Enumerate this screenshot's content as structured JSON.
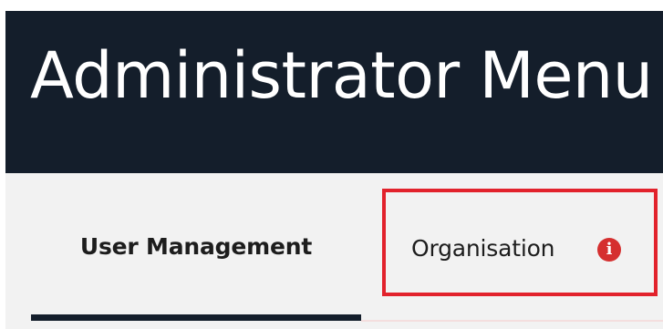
{
  "header": {
    "title": "Administrator Menu",
    "background": "#141e2b"
  },
  "tabs": [
    {
      "label": "User Management",
      "active": true
    },
    {
      "label": "Organisation",
      "active": false,
      "highlighted": true,
      "icon": "info-icon"
    }
  ],
  "colors": {
    "header_bg": "#141e2b",
    "tab_bar_bg": "#f2f2f2",
    "highlight_border": "#e2222c",
    "info_icon": "#d52f2f",
    "active_underline": "#141e2b"
  },
  "icons": {
    "info_glyph": "i"
  }
}
